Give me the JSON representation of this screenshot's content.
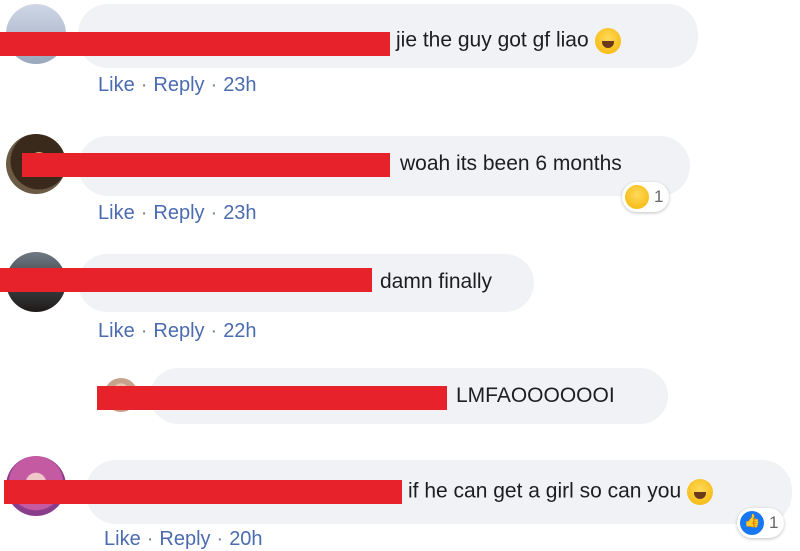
{
  "comments": [
    {
      "text": "jie the guy got gf liao",
      "actions": {
        "like": "Like",
        "reply": "Reply",
        "time": "23h"
      },
      "trailing_emoji": "grin-sweat-emoji-icon"
    },
    {
      "text": "woah its been 6 months",
      "actions": {
        "like": "Like",
        "reply": "Reply",
        "time": "23h"
      },
      "reaction": {
        "type": "haha",
        "count": "1"
      }
    },
    {
      "text": "damn finally",
      "actions": {
        "like": "Like",
        "reply": "Reply",
        "time": "22h"
      }
    },
    {
      "text": "LMFAOOOOOOI"
    },
    {
      "text": "if he can get a girl so can you",
      "actions": {
        "like": "Like",
        "reply": "Reply",
        "time": "20h"
      },
      "trailing_emoji": "rofl-emoji-icon",
      "reaction": {
        "type": "like",
        "count": "1"
      }
    }
  ],
  "colors": {
    "bubble": "#f0f2f5",
    "redaction": "#e8222b",
    "link": "#4b6bb0",
    "text": "#1c1e21"
  }
}
